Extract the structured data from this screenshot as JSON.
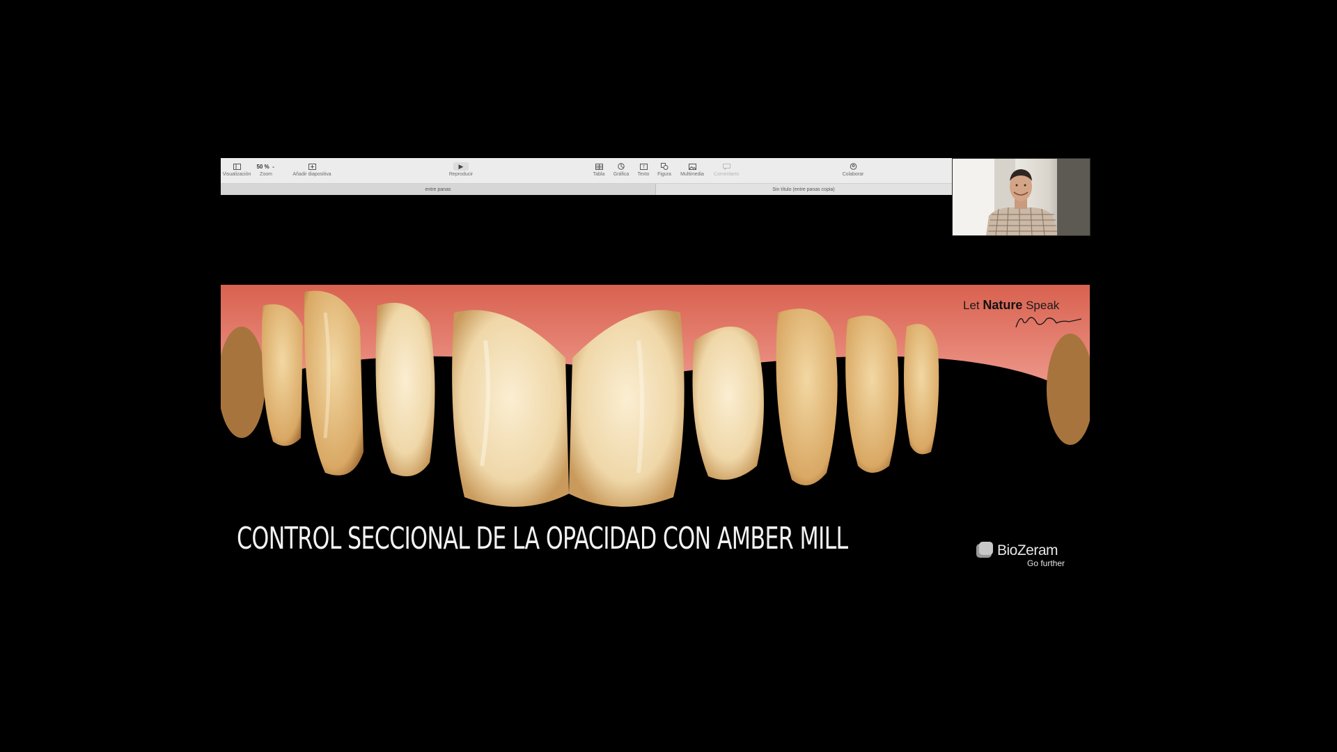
{
  "toolbar": {
    "view_label": "Visualización",
    "zoom_value": "50 %",
    "zoom_label": "Zoom",
    "add_slide_label": "Añadir diapositiva",
    "play_label": "Reproducir",
    "table_label": "Tabla",
    "chart_label": "Gráfica",
    "text_label": "Texto",
    "shape_label": "Figura",
    "media_label": "Multimedia",
    "comment_label": "Comentario",
    "collaborate_label": "Colaborar"
  },
  "tabs": [
    {
      "label": "entre panas",
      "active": true
    },
    {
      "label": "Sin título (entre panas copia)",
      "active": false
    }
  ],
  "slide": {
    "title": "CONTROL SECCIONAL DE LA OPACIDAD CON AMBER MILL",
    "watermark": {
      "let": "Let ",
      "nature": "Nature",
      "speak": " Speak",
      "signature": "by Javier Pérez"
    },
    "brand": {
      "name": "BioZeram",
      "tagline": "Go further"
    }
  },
  "colors": {
    "background": "#000000",
    "toolbar": "#ececec",
    "gum": "#e98c7e",
    "tooth": "#f1dcb4"
  }
}
